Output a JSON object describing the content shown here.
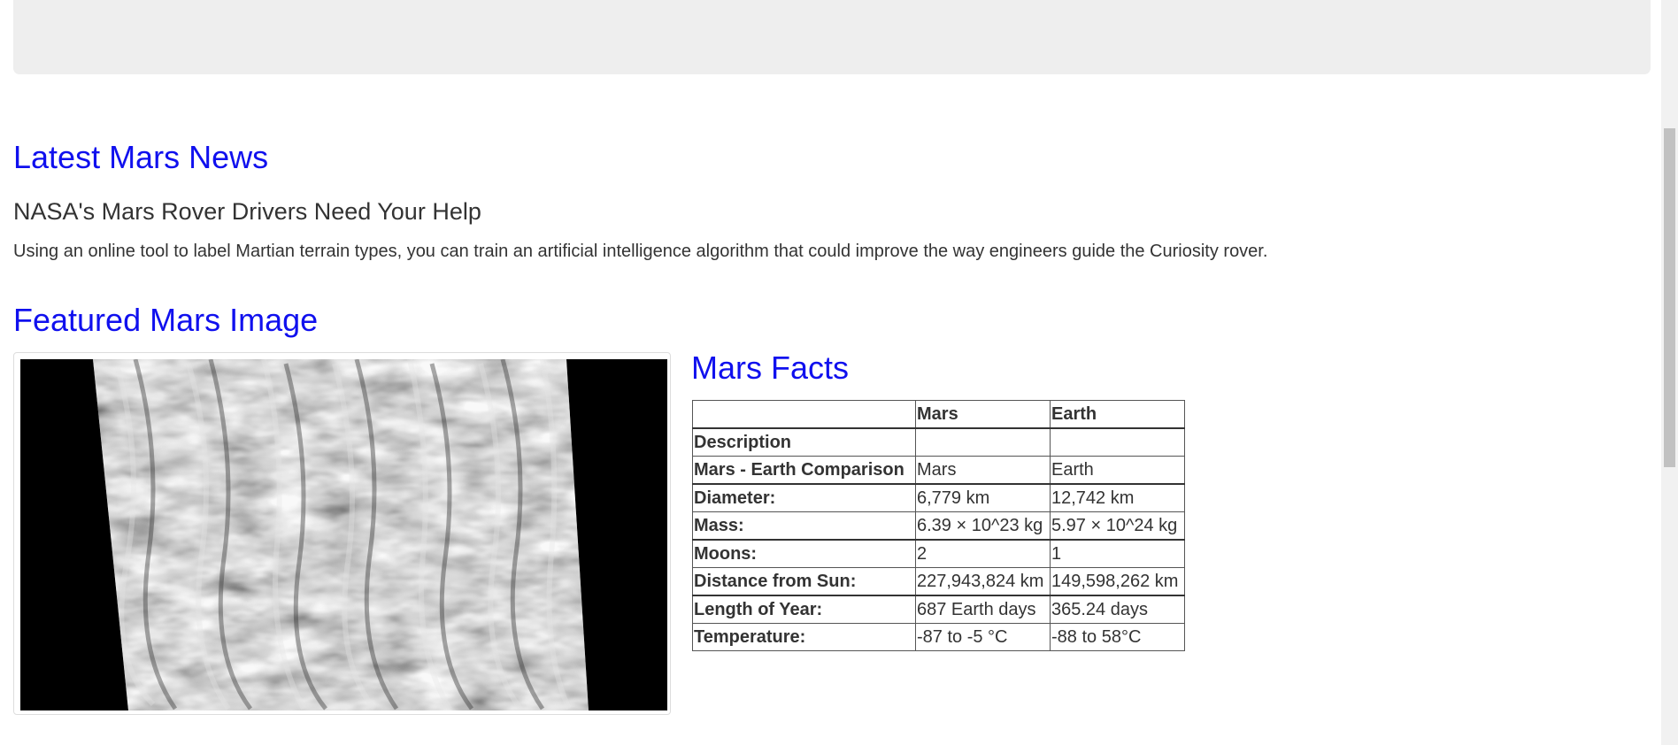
{
  "news": {
    "heading": "Latest Mars News",
    "title": "NASA's Mars Rover Drivers Need Your Help",
    "teaser": "Using an online tool to label Martian terrain types, you can train an artificial intelligence algorithm that could improve the way engineers guide the Curiosity rover."
  },
  "featured": {
    "heading": "Featured Mars Image"
  },
  "facts": {
    "heading": "Mars Facts",
    "columns": [
      "",
      "Mars",
      "Earth"
    ],
    "rows": [
      {
        "label": "Description",
        "mars": "",
        "earth": ""
      },
      {
        "label": "Mars - Earth Comparison",
        "mars": "Mars",
        "earth": "Earth"
      },
      {
        "label": "Diameter:",
        "mars": "6,779 km",
        "earth": "12,742 km"
      },
      {
        "label": "Mass:",
        "mars": "6.39 × 10^23 kg",
        "earth": "5.97 × 10^24 kg"
      },
      {
        "label": "Moons:",
        "mars": "2",
        "earth": "1"
      },
      {
        "label": "Distance from Sun:",
        "mars": "227,943,824 km",
        "earth": "149,598,262 km"
      },
      {
        "label": "Length of Year:",
        "mars": "687 Earth days",
        "earth": "365.24 days"
      },
      {
        "label": "Temperature:",
        "mars": "-87 to -5 °C",
        "earth": "-88 to 58°C"
      }
    ]
  },
  "colors": {
    "heading": "#1010ee",
    "text": "#333333",
    "jumbotron": "#eeeeee"
  }
}
